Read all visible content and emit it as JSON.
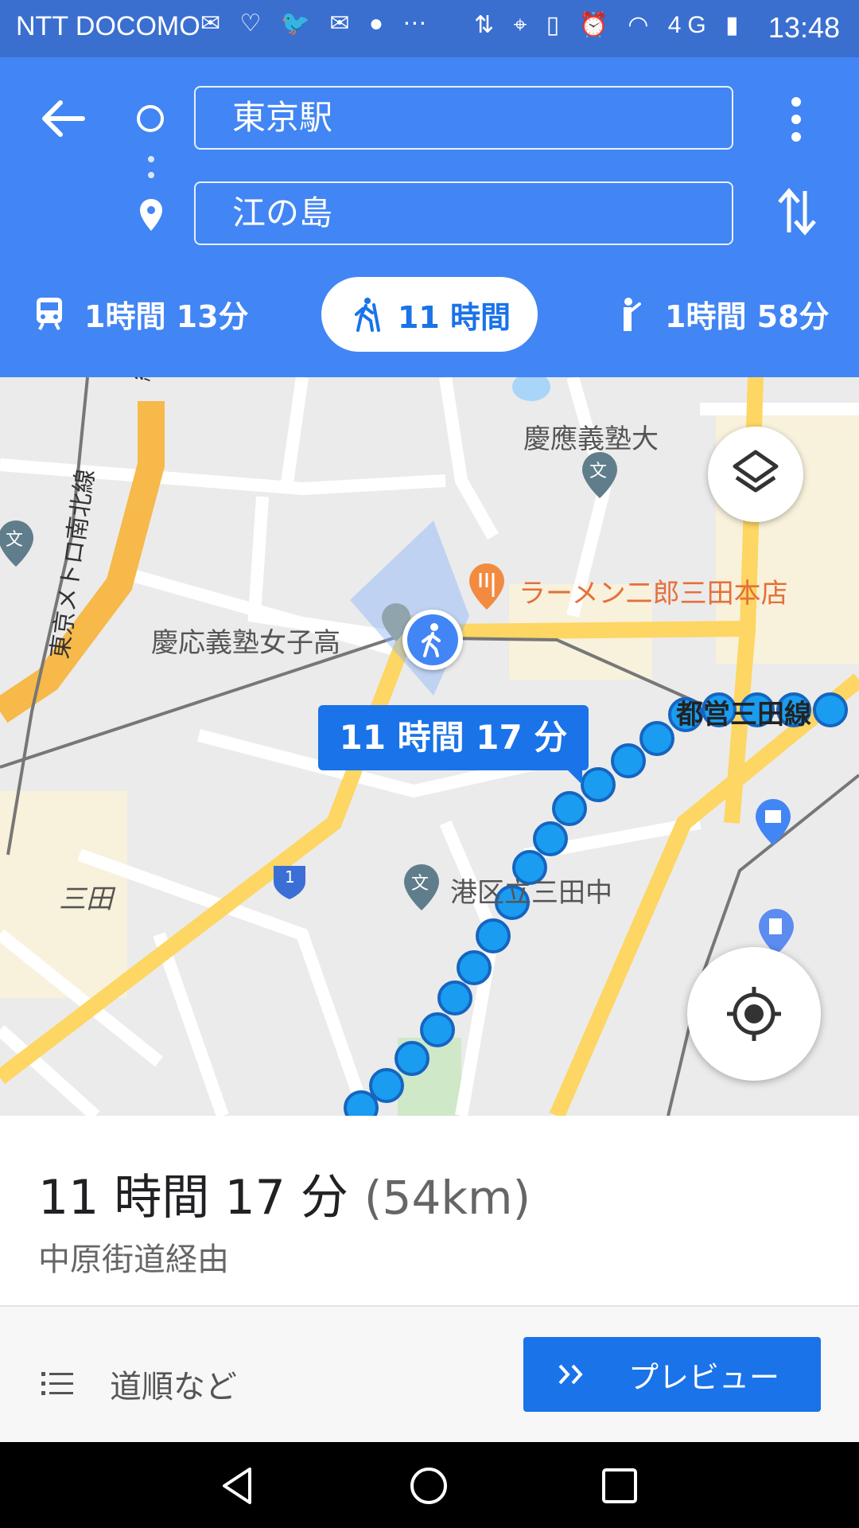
{
  "status_bar": {
    "carrier": "NTT DOCOMO",
    "notification_icons": [
      "mail-icon",
      "heart-rate-icon",
      "twitter-icon",
      "mail-icon",
      "line-icon",
      "more-icon"
    ],
    "notification_glyphs": "✉ ♡ 🐦 ✉ ● ⋯",
    "system_icons": [
      "data-icon",
      "location-icon",
      "vibrate-icon",
      "alarm-icon",
      "wifi-icon",
      "signal-4g-icon",
      "battery-icon"
    ],
    "system_glyphs": "⇅ ⌖ ▯ ⏰ ◠ 4G ▮",
    "time": "13:48"
  },
  "header": {
    "origin": "東京駅",
    "destination": "江の島",
    "modes": [
      {
        "icon": "train-icon",
        "label": "1時間 13分",
        "selected": false
      },
      {
        "icon": "walk-icon",
        "label": "11 時間",
        "selected": true
      },
      {
        "icon": "ride-hail-icon",
        "label": "1時間 58分",
        "selected": false
      }
    ]
  },
  "map": {
    "labels": {
      "keio_univ": "慶應義塾大",
      "ramen": "ラーメン二郎三田本店",
      "girls_high": "慶応義塾女子高",
      "mita_line": "都営三田線",
      "namboku_line": "東京メトロ南北線",
      "mita": "三田",
      "junior_high": "港区立三田中",
      "route_number": "1",
      "line_partial": "線",
      "school_marker": "文"
    },
    "callout": "11 時間 17 分",
    "colors": {
      "route": "#1a9cf0",
      "route_outline": "#1565c0",
      "major_road": "#fdd663",
      "expressway": "#f6b94a"
    }
  },
  "summary": {
    "duration": "11 時間 17 分",
    "distance": "(54km)",
    "via": "中原街道経由"
  },
  "actions": {
    "steps_label": "道順など",
    "preview_label": "プレビュー"
  }
}
